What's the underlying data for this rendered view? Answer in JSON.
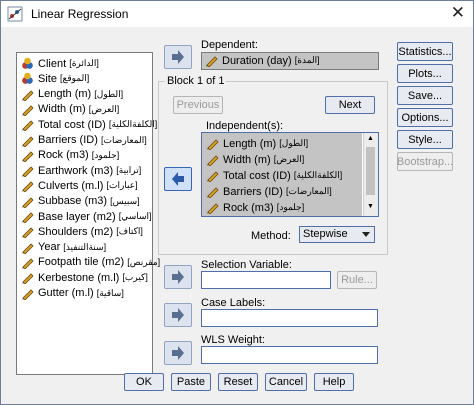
{
  "window": {
    "title": "Linear Regression",
    "close_glyph": "✕"
  },
  "colors": {
    "accent": "#4e6fa8",
    "selection": "#c4c4c4",
    "ruler": "#e0a020",
    "pencil": "#d8a024"
  },
  "variables": [
    {
      "label": "Client",
      "arabic": "[الدائرة]",
      "icon": "nominal-icon"
    },
    {
      "label": "Site",
      "arabic": "[الموقع]",
      "icon": "nominal-icon"
    },
    {
      "label": "Length (m)",
      "arabic": "[الطول]",
      "icon": "scale-icon"
    },
    {
      "label": "Width (m)",
      "arabic": "[العرض]",
      "icon": "scale-icon"
    },
    {
      "label": "Total cost (ID)",
      "arabic": "[الكلفةالكلية]",
      "icon": "scale-icon"
    },
    {
      "label": "Barriers (ID)",
      "arabic": "[المعارضات]",
      "icon": "scale-icon"
    },
    {
      "label": "Rock (m3)",
      "arabic": "[جلمود]",
      "icon": "scale-icon"
    },
    {
      "label": "Earthwork (m3)",
      "arabic": "[ترابية]",
      "icon": "scale-icon"
    },
    {
      "label": "Culverts (m.l)",
      "arabic": "[عبارات]",
      "icon": "scale-icon"
    },
    {
      "label": "Subbase (m3)",
      "arabic": "[سبيس]",
      "icon": "scale-icon"
    },
    {
      "label": "Base layer (m2)",
      "arabic": "[اساسي]",
      "icon": "scale-icon"
    },
    {
      "label": "Shoulders (m2)",
      "arabic": "[اكتاف]",
      "icon": "scale-icon"
    },
    {
      "label": "Year",
      "arabic": "[سنةالتنفيذ]",
      "icon": "scale-icon"
    },
    {
      "label": "Footpath tile (m2)",
      "arabic": "[مقرنص]",
      "icon": "scale-icon"
    },
    {
      "label": "Kerbestone (m.l)",
      "arabic": "[كيرب]",
      "icon": "scale-icon"
    },
    {
      "label": "Gutter (m.l)",
      "arabic": "[ساقية]",
      "icon": "scale-icon"
    }
  ],
  "dependent": {
    "label": "Dependent:",
    "value": "Duration (day)",
    "arabic": "[المدة]"
  },
  "block": {
    "label": "Block 1 of 1",
    "previous": "Previous",
    "next": "Next"
  },
  "independents": {
    "label": "Independent(s):",
    "items": [
      {
        "label": "Length (m)",
        "arabic": "[الطول]"
      },
      {
        "label": "Width (m)",
        "arabic": "[العرض]"
      },
      {
        "label": "Total cost (ID)",
        "arabic": "[الكلفةالكلية]"
      },
      {
        "label": "Barriers (ID)",
        "arabic": "[المعارضات]"
      },
      {
        "label": "Rock (m3)",
        "arabic": "[جلمود]"
      }
    ]
  },
  "method": {
    "label": "Method:",
    "value": "Stepwise"
  },
  "selection_variable": {
    "label": "Selection Variable:",
    "rule": "Rule..."
  },
  "case_labels": {
    "label": "Case Labels:"
  },
  "wls_weight": {
    "label": "WLS Weight:"
  },
  "side_buttons": [
    "Statistics...",
    "Plots...",
    "Save...",
    "Options...",
    "Style...",
    "Bootstrap..."
  ],
  "bottom_buttons": [
    "OK",
    "Paste",
    "Reset",
    "Cancel",
    "Help"
  ]
}
